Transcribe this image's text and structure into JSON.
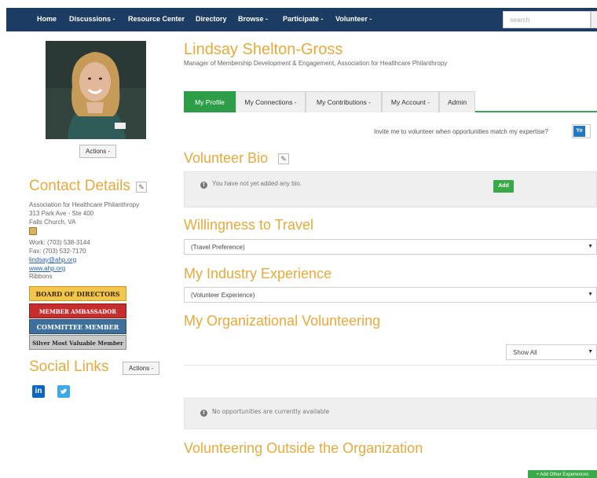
{
  "nav": {
    "items": [
      {
        "label": "Home"
      },
      {
        "label": "Discussions -"
      },
      {
        "label": "Resource Center"
      },
      {
        "label": "Directory"
      },
      {
        "label": "Browse -"
      },
      {
        "label": "Participate -"
      },
      {
        "label": "Volunteer -"
      }
    ],
    "search_placeholder": "search",
    "search_button": "Q"
  },
  "profile": {
    "actions_label": "Actions -",
    "name": "Lindsay Shelton-Gross",
    "subtitle": "Manager of Membership Development & Engagement, Association for Healthcare Philanthropy"
  },
  "contact": {
    "title": "Contact Details",
    "org": "Association for Healthcare Philanthropy",
    "address": "313 Park Ave - Ste 400",
    "city": "Falls Church, VA",
    "work": "Work: (703) 538-3144",
    "fax": "Fax: (703) 532-7170",
    "email": "lindsay@ahp.org",
    "website": "www.ahp.org",
    "ribbons_label": "Ribbons",
    "ribbons": [
      {
        "label": "BOARD OF DIRECTORS"
      },
      {
        "label": "MEMBER AMBASSADOR"
      },
      {
        "label": "COMMITTEE MEMBER"
      },
      {
        "label": "Silver Most Valuable Member"
      }
    ]
  },
  "social": {
    "title": "Social Links",
    "actions_label": "Actions -",
    "linkedin_glyph": "in"
  },
  "tabs": [
    {
      "label": "My Profile"
    },
    {
      "label": "My Connections -"
    },
    {
      "label": "My Contributions -"
    },
    {
      "label": "My Account -"
    },
    {
      "label": "Admin"
    }
  ],
  "invite": {
    "text": "Invite me to volunteer when opportunities match my expertise?",
    "toggle_label": "Ye"
  },
  "bio": {
    "title": "Volunteer Bio",
    "message": "You have not yet added any bio.",
    "add_label": "Add"
  },
  "travel": {
    "title": "Willingness to Travel",
    "value": "(Travel Preference)"
  },
  "industry": {
    "title": "My Industry Experience",
    "value": "(Volunteer Experience)"
  },
  "org_volunteering": {
    "title": "My Organizational Volunteering",
    "filter": "Show All",
    "message": "No opportunities are currently available"
  },
  "outside": {
    "title": "Volunteering Outside the Organization",
    "add_label": "+ Add Other Experiences"
  },
  "colors": {
    "nav": "#1d3c63",
    "accent": "#e8a93b",
    "green": "#2e9d48",
    "link": "#2a62b0"
  }
}
